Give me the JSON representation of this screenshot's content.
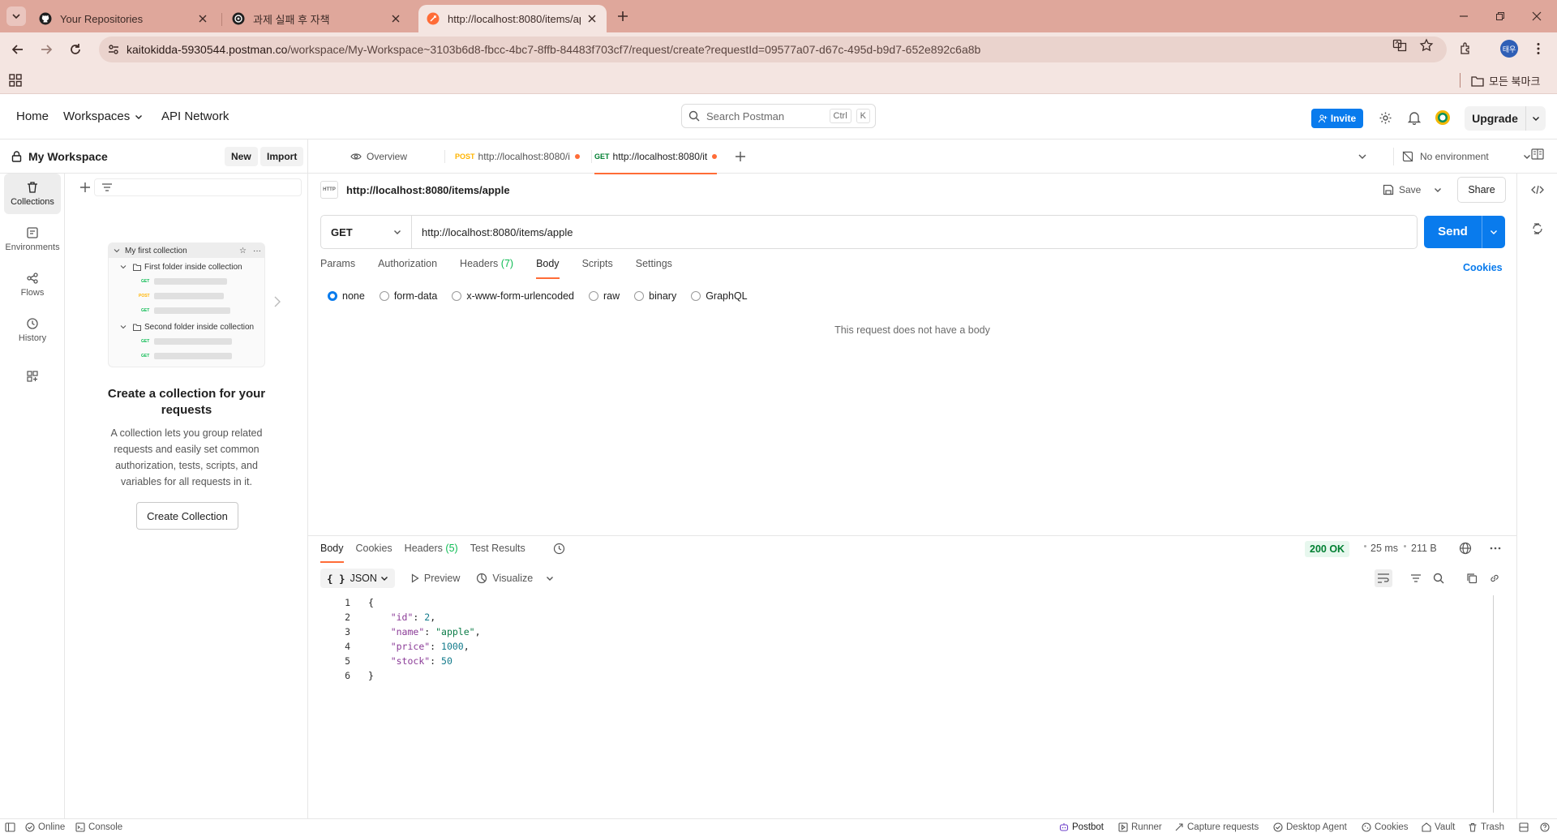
{
  "browser": {
    "tabs": [
      {
        "title": "Your Repositories"
      },
      {
        "title": "과제 실패 후 자책"
      },
      {
        "title": "http://localhost:8080/items/apple"
      }
    ],
    "url_host": "kaitokidda-5930544.postman.co",
    "url_path": "/workspace/My-Workspace~3103b6d8-fbcc-4bc7-8ffb-84483f703cf7/request/create?requestId=09577a07-d67c-495d-b9d7-652e892c6a8b",
    "profile_initials": "태우",
    "bookmarks_all": "모든 북마크"
  },
  "header": {
    "home": "Home",
    "workspaces": "Workspaces",
    "api_network": "API Network",
    "search_placeholder": "Search Postman",
    "shortcut_ctrl": "Ctrl",
    "shortcut_k": "K",
    "invite": "Invite",
    "upgrade": "Upgrade"
  },
  "workspace": {
    "title": "My Workspace",
    "new_label": "New",
    "import_label": "Import"
  },
  "rail": [
    {
      "label": "Collections"
    },
    {
      "label": "Environments"
    },
    {
      "label": "Flows"
    },
    {
      "label": "History"
    }
  ],
  "side_panel": {
    "illustration": {
      "collection": "My first collection",
      "folder1": "First folder inside collection",
      "folder2": "Second folder inside collection",
      "get": "GET",
      "post": "POST"
    },
    "empty_title": "Create a collection for your requests",
    "empty_desc": "A collection lets you group related requests and easily set common authorization, tests, scripts, and variables for all requests in it.",
    "create_button": "Create Collection"
  },
  "main_tabs": [
    {
      "label": "Overview"
    },
    {
      "method": "POST",
      "label": "http://localhost:8080/i"
    },
    {
      "method": "GET",
      "label": "http://localhost:8080/it"
    }
  ],
  "environment": "No environment",
  "request": {
    "title": "http://localhost:8080/items/apple",
    "http_icon": "HTTP",
    "save": "Save",
    "share": "Share",
    "method": "GET",
    "url": "http://localhost:8080/items/apple",
    "send": "Send",
    "tabs": {
      "params": "Params",
      "authorization": "Authorization",
      "headers": "Headers",
      "headers_count": "(7)",
      "body": "Body",
      "scripts": "Scripts",
      "settings": "Settings"
    },
    "cookies": "Cookies",
    "body_types": [
      "none",
      "form-data",
      "x-www-form-urlencoded",
      "raw",
      "binary",
      "GraphQL"
    ],
    "no_body": "This request does not have a body"
  },
  "response": {
    "tabs": {
      "body": "Body",
      "cookies": "Cookies",
      "headers": "Headers",
      "headers_count": "(5)",
      "test_results": "Test Results"
    },
    "status": "200 OK",
    "time": "25 ms",
    "size": "211 B",
    "format": "JSON",
    "format_glyph": "{ }",
    "preview": "Preview",
    "visualize": "Visualize",
    "lines": [
      "1",
      "2",
      "3",
      "4",
      "5",
      "6"
    ],
    "json": {
      "open": "{",
      "close": "}",
      "id_key": "\"id\"",
      "id_val": "2",
      "name_key": "\"name\"",
      "name_val": "\"apple\"",
      "price_key": "\"price\"",
      "price_val": "1000",
      "stock_key": "\"stock\"",
      "stock_val": "50"
    }
  },
  "statusbar": {
    "online": "Online",
    "console": "Console",
    "postbot": "Postbot",
    "runner": "Runner",
    "capture": "Capture requests",
    "desktop_agent": "Desktop Agent",
    "cookies": "Cookies",
    "vault": "Vault",
    "trash": "Trash"
  },
  "colors": {
    "accent_orange": "#ff6c37",
    "primary_blue": "#097bed",
    "status_green": "#007f31",
    "browser_frame": "#dfa79b"
  }
}
